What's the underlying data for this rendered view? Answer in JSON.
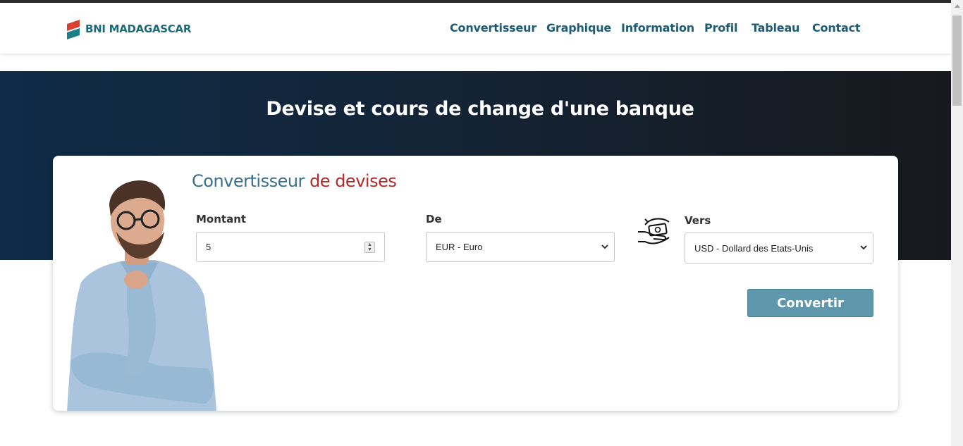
{
  "brand": {
    "name": "BNI MADAGASCAR",
    "colors": {
      "primary": "#1c6b7a",
      "accent": "#d8402f"
    }
  },
  "nav": {
    "items": [
      {
        "label": "Convertisseur"
      },
      {
        "label": "Graphique"
      },
      {
        "label": "Information"
      },
      {
        "label": "Profil"
      },
      {
        "label": "Tableau"
      },
      {
        "label": "Contact"
      }
    ]
  },
  "hero": {
    "title": "Devise et cours de change d'une banque"
  },
  "converter": {
    "title_part1": "Convertisseur",
    "title_part2": "de devises",
    "amount": {
      "label": "Montant",
      "value": "5"
    },
    "from": {
      "label": "De",
      "selected": "EUR - Euro"
    },
    "to": {
      "label": "Vers",
      "selected": "USD - Dollard des Etats-Unis"
    },
    "swap_icon": "money-exchange-icon",
    "button_label": "Convertir",
    "image": "thinking-man-illustration"
  }
}
